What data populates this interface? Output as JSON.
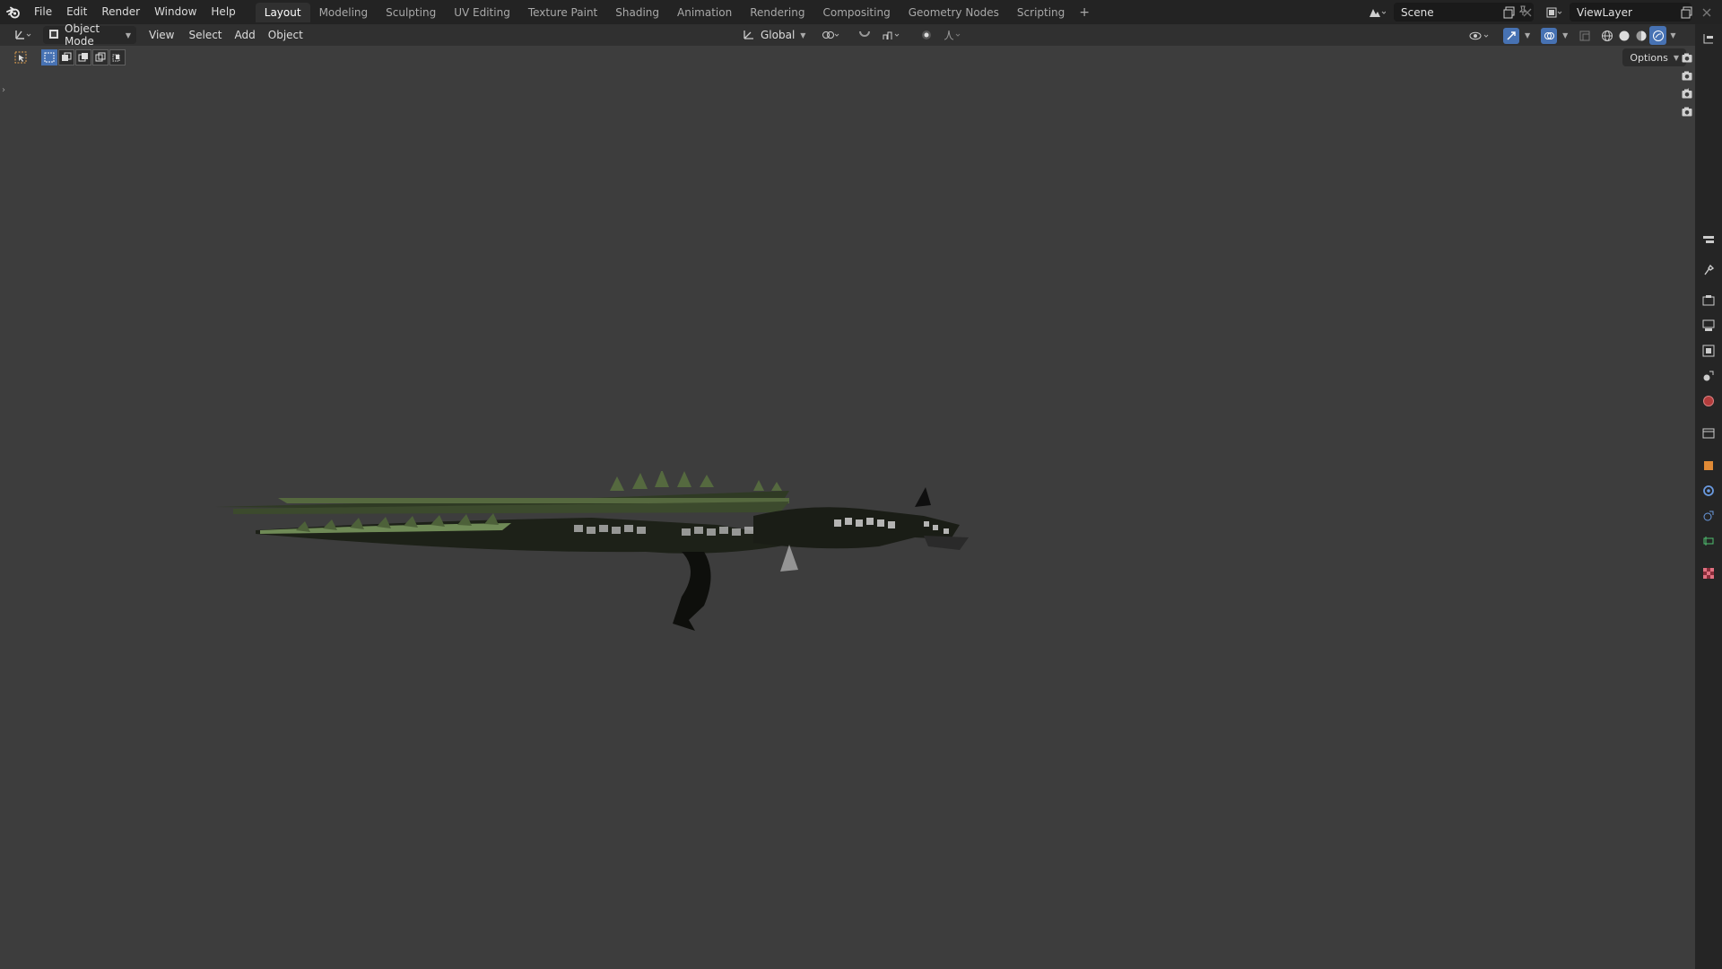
{
  "topbar": {
    "menus": [
      "File",
      "Edit",
      "Render",
      "Window",
      "Help"
    ],
    "workspaces": [
      "Layout",
      "Modeling",
      "Sculpting",
      "UV Editing",
      "Texture Paint",
      "Shading",
      "Animation",
      "Rendering",
      "Compositing",
      "Geometry Nodes",
      "Scripting"
    ],
    "active_workspace": "Layout",
    "add_workspace": "+",
    "scene": "Scene",
    "view_layer": "ViewLayer"
  },
  "header": {
    "mode": "Object Mode",
    "menus": [
      "View",
      "Select",
      "Add",
      "Object"
    ],
    "transform_orientation": "Global"
  },
  "viewport": {
    "options_label": "Options",
    "background_color": "#3d3d3d",
    "object": "dragon-model"
  },
  "colors": {
    "accent": "#4772b3",
    "topbar": "#232323",
    "header": "#303030",
    "viewport": "#3d3d3d"
  }
}
